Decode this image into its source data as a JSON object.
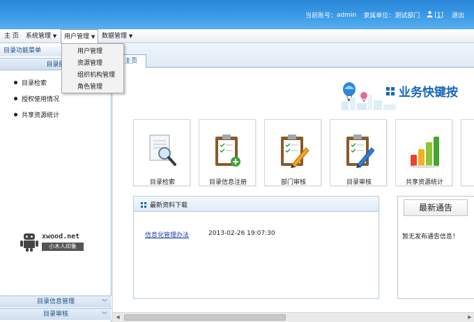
{
  "header": {
    "account_label": "当前账号：",
    "account_value": "admin",
    "unit_label": "隶属单位：",
    "unit_value": "测试部门",
    "user_icon": "user-icon",
    "message_count": "[1]",
    "logout": "退出"
  },
  "menubar": {
    "items": [
      {
        "label": "主 页"
      },
      {
        "label": "系统管理",
        "caret": "▼"
      },
      {
        "label": "用户管理",
        "caret": "▼"
      },
      {
        "label": "数据管理",
        "caret": "▼"
      }
    ]
  },
  "dropdown": {
    "items": [
      "用户管理",
      "资源管理",
      "组织机构管理",
      "角色管理"
    ]
  },
  "sidebar": {
    "title": "目录功能菜单",
    "section": "目录服",
    "items": [
      "目录检索",
      "授权使用情况",
      "共享资源统计"
    ],
    "watermark_text": "xwood.net",
    "watermark_sub": "小木人印象",
    "accordions": [
      {
        "label": "目录信息管理",
        "chevron": "«"
      },
      {
        "label": "目录审核",
        "chevron": "«"
      }
    ]
  },
  "main": {
    "tab": "主页",
    "banner_title": "业务快键按",
    "cards": [
      {
        "label": "目录检索",
        "icon": "magnifier-document-icon"
      },
      {
        "label": "目录信息注册",
        "icon": "clipboard-add-icon"
      },
      {
        "label": "部门审核",
        "icon": "clipboard-pencil-icon"
      },
      {
        "label": "目录审核",
        "icon": "clipboard-blue-pencil-icon"
      },
      {
        "label": "共享资源统计",
        "icon": "bar-chart-icon"
      }
    ],
    "downloads": {
      "title": "最新资料下载",
      "rows": [
        {
          "name": "信息化管理办法",
          "date": "2013-02-26 19:07:30"
        }
      ]
    },
    "notice": {
      "title": "最新通告",
      "body": "暂无发布通告信息！"
    }
  },
  "colors": {
    "header_blue": "#3b9be6",
    "link_blue": "#1a3fa8",
    "title_blue": "#1769b8"
  }
}
